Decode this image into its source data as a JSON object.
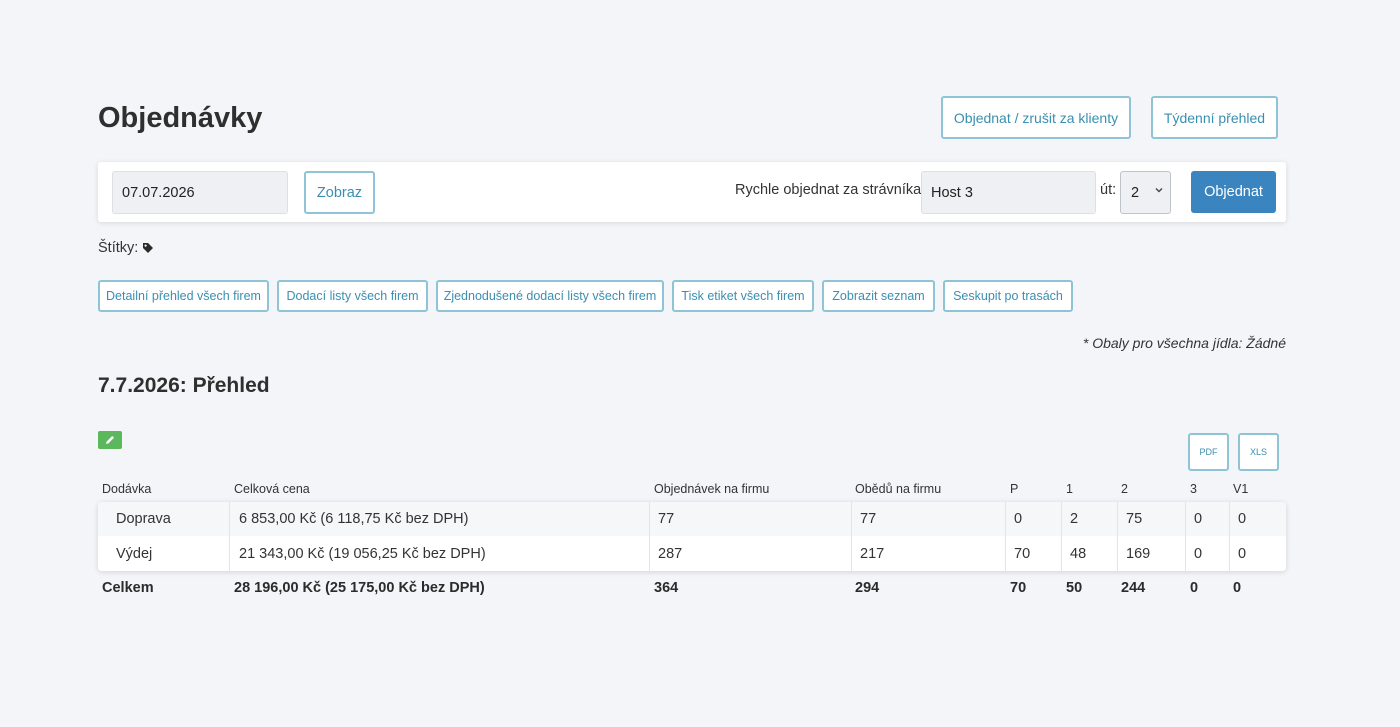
{
  "header": {
    "title": "Objednávky",
    "order_cancel_label": "Objednat / zrušit za klienty",
    "weekly_label": "Týdenní přehled"
  },
  "toolbar": {
    "date_value": "07.07.2026",
    "show_label": "Zobraz",
    "quick_order_label": "Rychle objednat za strávníka:",
    "diner_value": "Host 3",
    "day_label": "út:",
    "qty_value": "2",
    "order_label": "Objednat"
  },
  "tags": {
    "label": "Štítky:"
  },
  "actions": [
    "Detailní přehled všech firem",
    "Dodací listy všech firem",
    "Zjednodušené dodací listy všech firem",
    "Tisk etiket všech firem",
    "Zobrazit seznam",
    "Seskupit po trasách"
  ],
  "note": "* Obaly pro všechna jídla: Žádné",
  "section": {
    "title": "7.7.2026: Přehled"
  },
  "export": {
    "pdf": "PDF",
    "xls": "XLS"
  },
  "table": {
    "columns": [
      "Dodávka",
      "Celková cena",
      "Objednávek na firmu",
      "Obědů na firmu",
      "P",
      "1",
      "2",
      "3",
      "V1"
    ],
    "rows": [
      [
        "Doprava",
        "6 853,00 Kč (6 118,75 Kč bez DPH)",
        "77",
        "77",
        "0",
        "2",
        "75",
        "0",
        "0"
      ],
      [
        "Výdej",
        "21 343,00 Kč (19 056,25 Kč bez DPH)",
        "287",
        "217",
        "70",
        "48",
        "169",
        "0",
        "0"
      ]
    ],
    "totals": [
      "Celkem",
      "28 196,00 Kč (25 175,00 Kč bez DPH)",
      "364",
      "294",
      "70",
      "50",
      "244",
      "0",
      "0"
    ]
  },
  "colors": {
    "accent": "#3a84bf",
    "outline": "#8fc4d6",
    "edit": "#5cb85c",
    "background": "#f4f5f9"
  }
}
